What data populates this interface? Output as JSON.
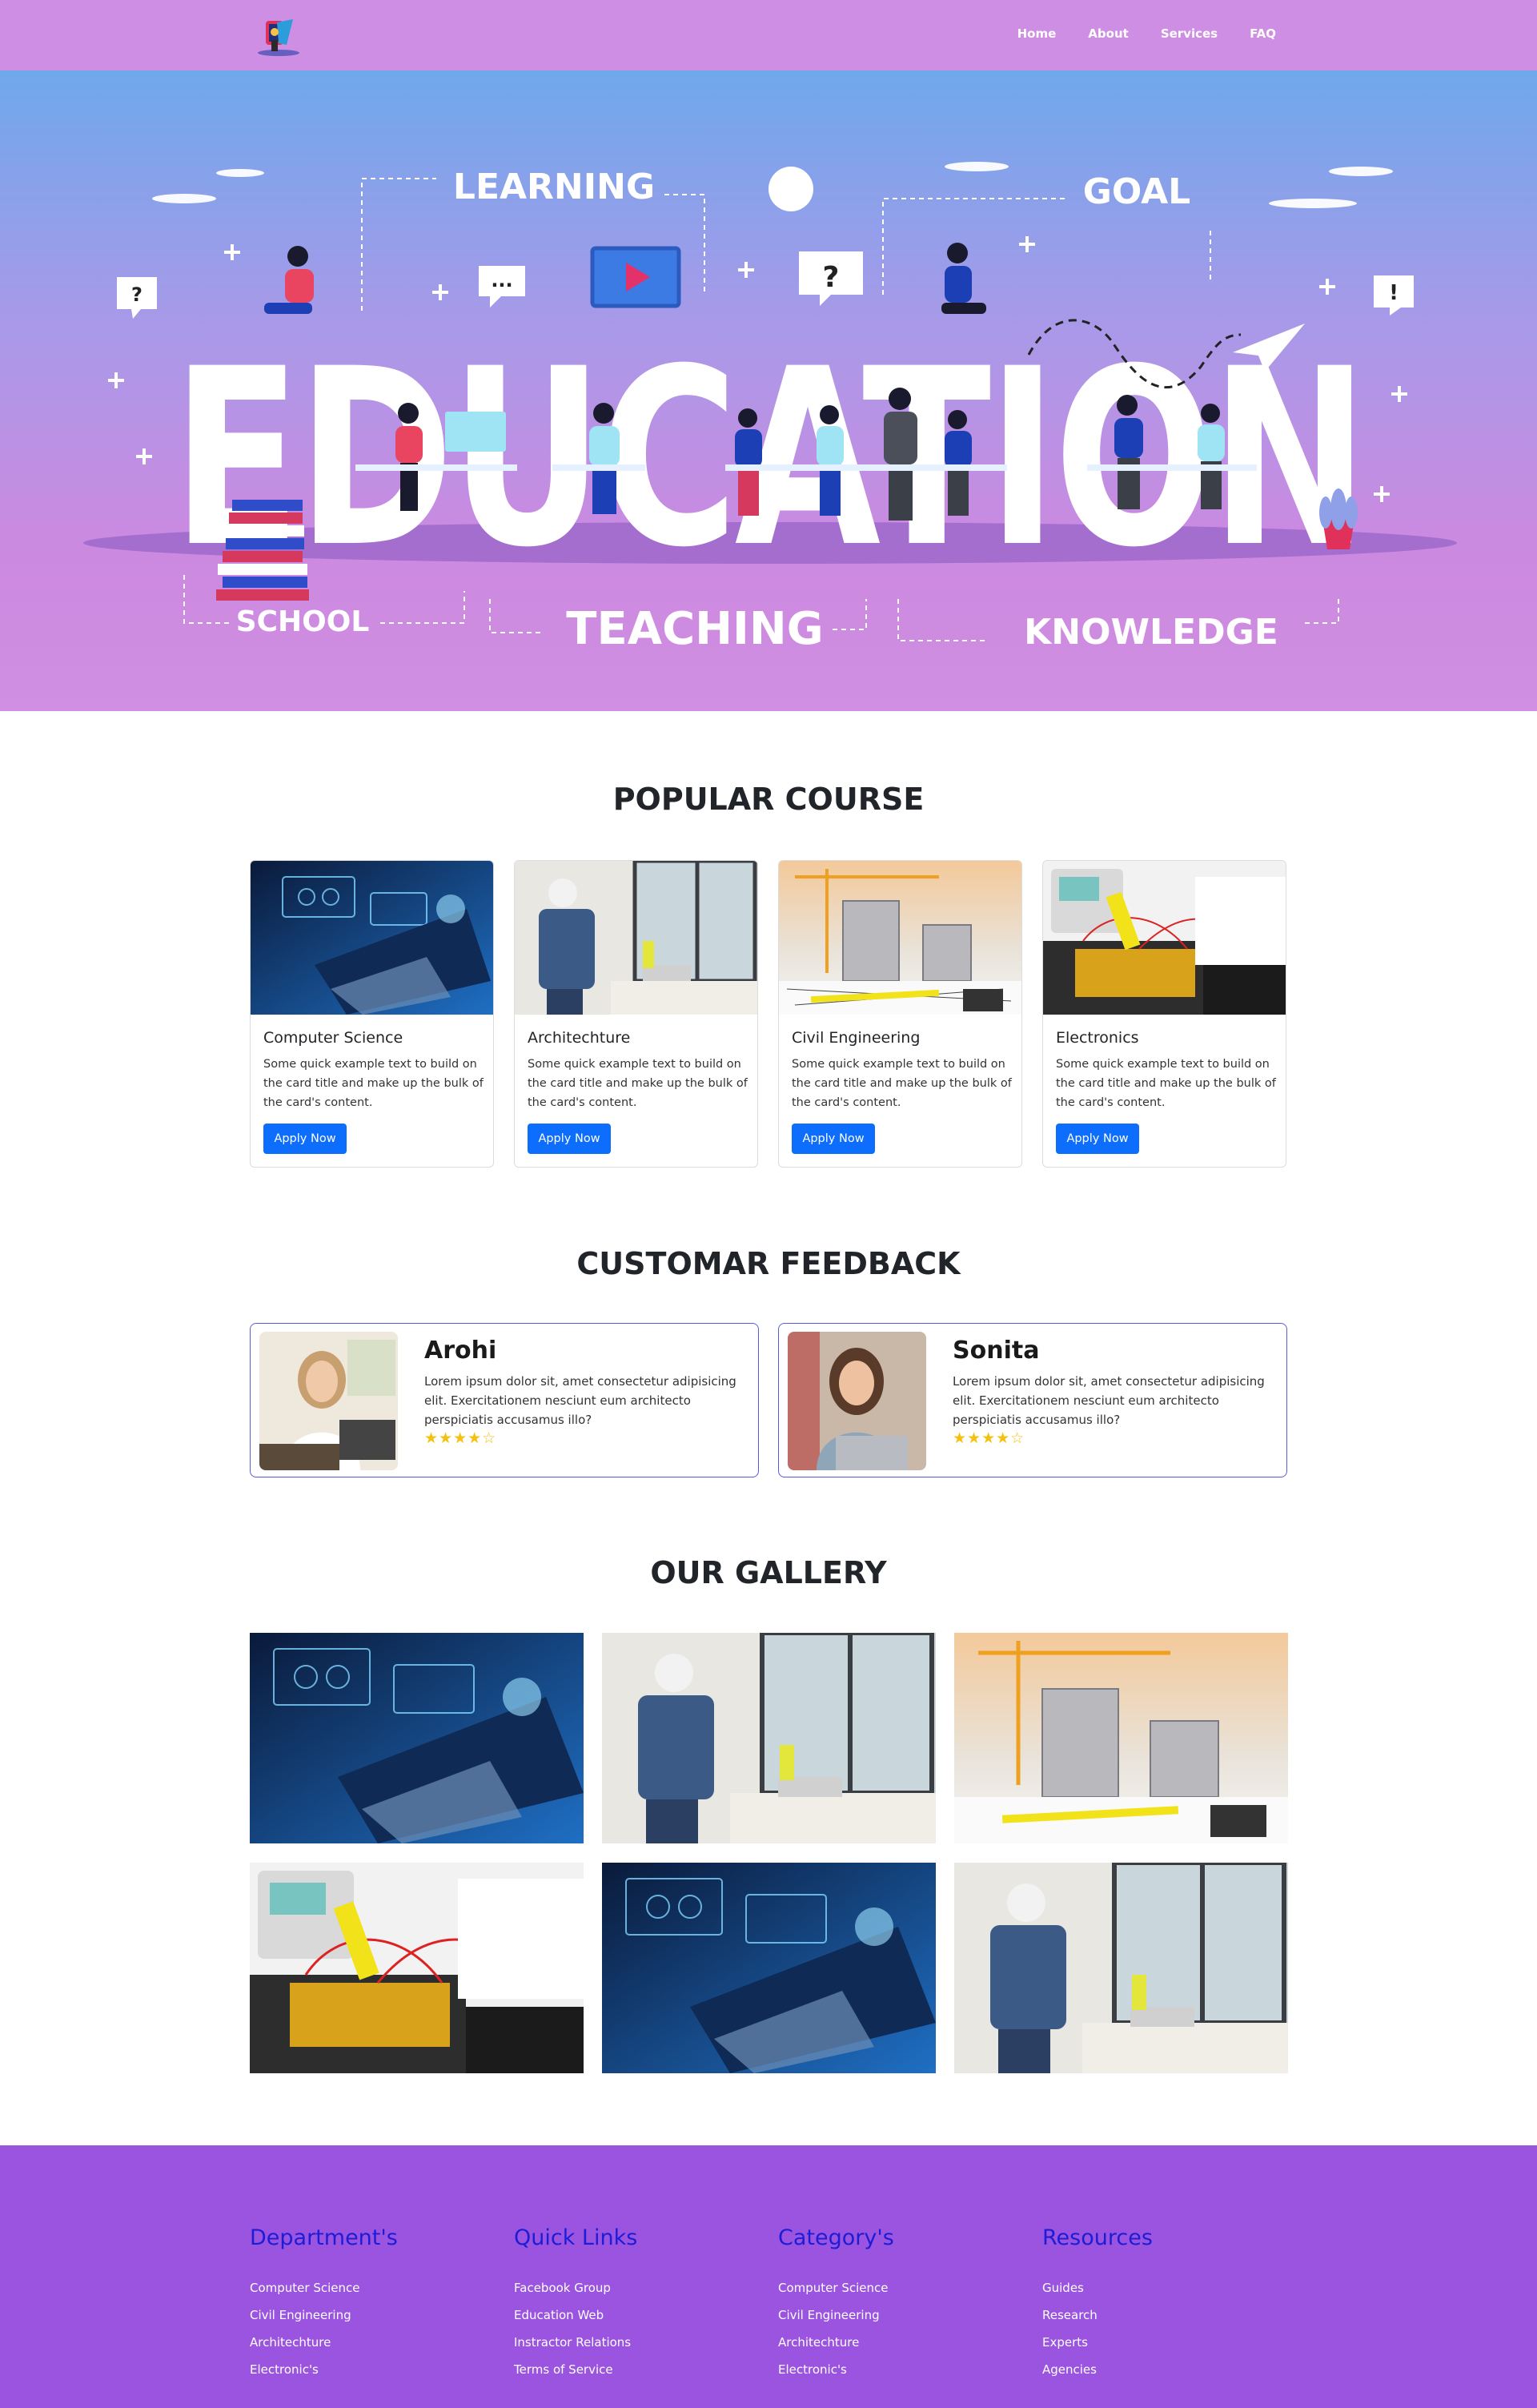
{
  "nav": {
    "links": [
      "Home",
      "About",
      "Services",
      "FAQ"
    ]
  },
  "hero": {
    "words": [
      "LEARNING",
      "GOAL",
      "EDUCATION",
      "SCHOOL",
      "TEACHING",
      "KNOWLEDGE"
    ]
  },
  "courses": {
    "title": "POPULAR COURSE",
    "items": [
      {
        "title": "Computer Science",
        "text": "Some quick example text to build on the card title and make up the bulk of the card's content.",
        "button": "Apply Now"
      },
      {
        "title": "Architechture",
        "text": "Some quick example text to build on the card title and make up the bulk of the card's content.",
        "button": "Apply Now"
      },
      {
        "title": "Civil Engineering",
        "text": "Some quick example text to build on the card title and make up the bulk of the card's content.",
        "button": "Apply Now"
      },
      {
        "title": "Electronics",
        "text": "Some quick example text to build on the card title and make up the bulk of the card's content.",
        "button": "Apply Now"
      }
    ]
  },
  "feedback": {
    "title": "CUSTOMAR FEEDBACK",
    "items": [
      {
        "name": "Arohi",
        "text": "Lorem ipsum dolor sit, amet consectetur adipisicing elit. Exercitationem nesciunt eum architecto perspiciatis accusamus illo?",
        "rating": 4,
        "stars": "★★★★☆"
      },
      {
        "name": "Sonita",
        "text": "Lorem ipsum dolor sit, amet consectetur adipisicing elit. Exercitationem nesciunt eum architecto perspiciatis accusamus illo?",
        "rating": 4,
        "stars": "★★★★☆"
      }
    ]
  },
  "gallery": {
    "title": "OUR GALLERY"
  },
  "footer": {
    "columns": [
      {
        "heading": "Department's",
        "links": [
          "Computer Science",
          "Civil Engineering",
          "Architechture",
          "Electronic's"
        ]
      },
      {
        "heading": "Quick Links",
        "links": [
          "Facebook Group",
          "Education Web",
          "Instractor Relations",
          "Terms of Service"
        ]
      },
      {
        "heading": "Category's",
        "links": [
          "Computer Science",
          "Civil Engineering",
          "Architechture",
          "Electronic's"
        ]
      },
      {
        "heading": "Resources",
        "links": [
          "Guides",
          "Research",
          "Experts",
          "Agencies"
        ]
      }
    ]
  },
  "colors": {
    "navbar": "#cd8ee3",
    "primary_button": "#0d6efd",
    "footer": "#9b54e0",
    "footer_heading": "#1d1dd6",
    "star": "#f4c10f"
  }
}
